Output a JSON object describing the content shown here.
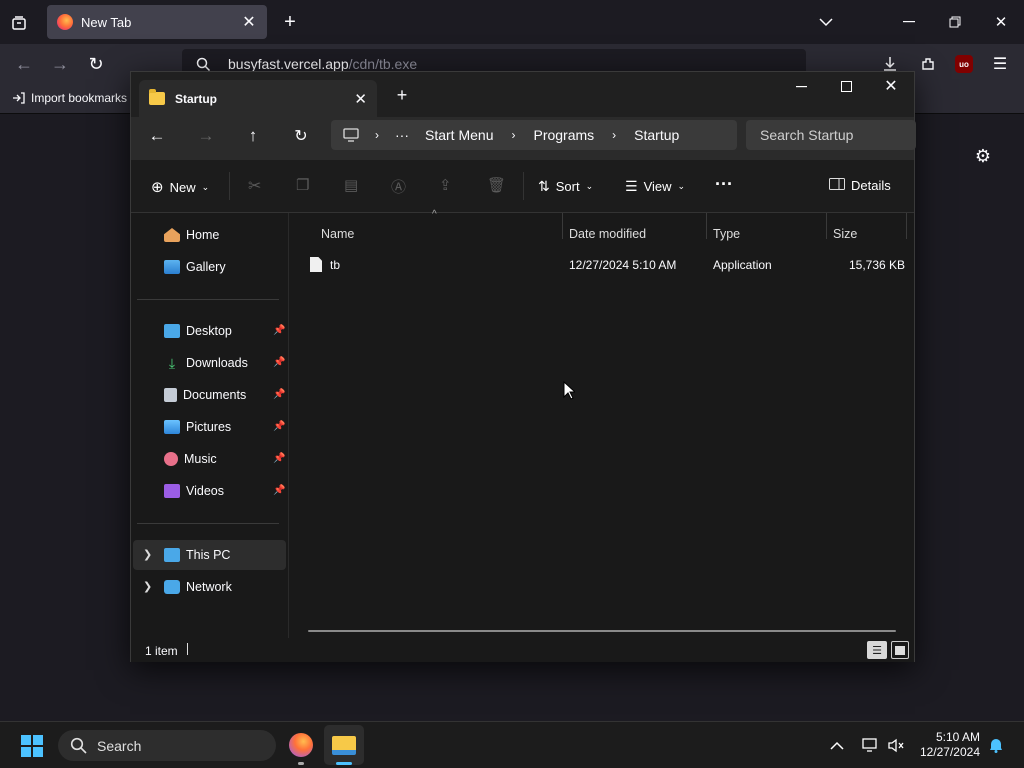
{
  "browser": {
    "tab_title": "New Tab",
    "url_host": "busyfast.vercel.app",
    "url_path": "/cdn/tb.exe",
    "import_bookmarks": "Import bookmarks...",
    "import_bookmarks_display": "Import bookmarks",
    "addon_badge": "uo"
  },
  "explorer": {
    "tab_title": "Startup",
    "breadcrumb": [
      "Start Menu",
      "Programs",
      "Startup"
    ],
    "search_placeholder": "Search Startup",
    "toolbar": {
      "new": "New",
      "sort": "Sort",
      "view": "View",
      "details": "Details"
    },
    "nav": {
      "home": "Home",
      "gallery": "Gallery",
      "desktop": "Desktop",
      "downloads": "Downloads",
      "documents": "Documents",
      "pictures": "Pictures",
      "music": "Music",
      "videos": "Videos",
      "this_pc": "This PC",
      "network": "Network"
    },
    "columns": {
      "name": "Name",
      "date": "Date modified",
      "type": "Type",
      "size": "Size"
    },
    "files": [
      {
        "name": "tb",
        "date": "12/27/2024 5:10 AM",
        "type": "Application",
        "size": "15,736 KB"
      }
    ],
    "status": "1 item"
  },
  "taskbar": {
    "search": "Search",
    "time": "5:10 AM",
    "date": "12/27/2024"
  },
  "colors": {
    "accent": "#4cc2ff",
    "folder": "#f7c948",
    "firefox": "#ff7139"
  }
}
